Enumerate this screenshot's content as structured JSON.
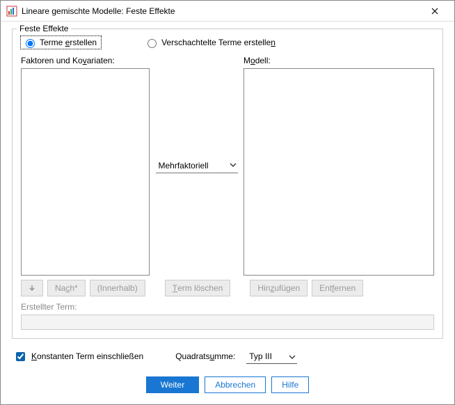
{
  "window": {
    "title": "Lineare gemischte Modelle: Feste Effekte"
  },
  "group": {
    "label": "Feste Effekte",
    "radio": {
      "build_prefix": "Terme ",
      "build_u": "e",
      "build_suffix": "rstellen",
      "nested_prefix": "Verschachtelte Terme erstelle",
      "nested_u": "n",
      "nested_suffix": ""
    },
    "labels": {
      "factors_prefix": "Faktoren und Ko",
      "factors_u": "v",
      "factors_suffix": "ariaten:",
      "model_prefix": "M",
      "model_u": "o",
      "model_suffix": "dell:",
      "created_term": "Erstellter Term:"
    },
    "type_dropdown": {
      "selected": "Mehrfaktoriell"
    },
    "buttons": {
      "by_prefix": "Na",
      "by_u": "c",
      "by_suffix": "h*",
      "within": "(Innerhalb)",
      "clear_prefix": "",
      "clear_u": "T",
      "clear_suffix": "erm löschen",
      "add_prefix": "Hin",
      "add_u": "z",
      "add_suffix": "ufügen",
      "remove_prefix": "Ent",
      "remove_u": "f",
      "remove_suffix": "ernen"
    }
  },
  "bottom": {
    "intercept_prefix": "",
    "intercept_u": "K",
    "intercept_suffix": "onstanten Term einschließen",
    "intercept_checked": true,
    "ss_label_prefix": "Quadrats",
    "ss_label_u": "u",
    "ss_label_suffix": "mme:",
    "ss_selected": "Typ III"
  },
  "footer": {
    "continue": "Weiter",
    "cancel": "Abbrechen",
    "help": "Hilfe"
  }
}
